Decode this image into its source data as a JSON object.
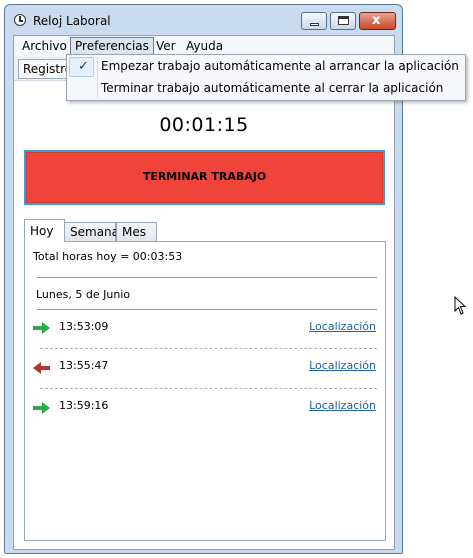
{
  "window": {
    "title": "Reloj Laboral",
    "close_glyph": "x"
  },
  "menubar": {
    "items": [
      "Archivo",
      "Preferencias",
      "Ver",
      "Ayuda"
    ]
  },
  "toolbar": {
    "registro_label": "Registro"
  },
  "timer": {
    "value": "00:01:15"
  },
  "main_button": {
    "label": "TERMINAR TRABAJO",
    "color": "#f0433a"
  },
  "tabs": {
    "items": [
      "Hoy",
      "Semana",
      "Mes"
    ],
    "selected": "Hoy"
  },
  "today": {
    "total_text": "Total horas hoy = 00:03:53",
    "date": "Lunes, 5 de Junio",
    "entries": [
      {
        "direction": "in",
        "icon": "green-arrow-right-icon",
        "time": "13:53:09",
        "link": "Localización"
      },
      {
        "direction": "out",
        "icon": "red-arrow-left-icon",
        "time": "13:55:47",
        "link": "Localización"
      },
      {
        "direction": "in",
        "icon": "green-arrow-right-icon",
        "time": "13:59:16",
        "link": "Localización"
      }
    ]
  },
  "preferences_menu": {
    "items": [
      {
        "label": "Empezar trabajo automáticamente al arrancar la aplicación",
        "checked": true,
        "check_glyph": "✓"
      },
      {
        "label": "Terminar trabajo automáticamente al cerrar la aplicación",
        "checked": false
      }
    ]
  },
  "colors": {
    "arrow_in": "#2da84a",
    "arrow_out": "#b3352b",
    "link": "#1f5fa6"
  }
}
